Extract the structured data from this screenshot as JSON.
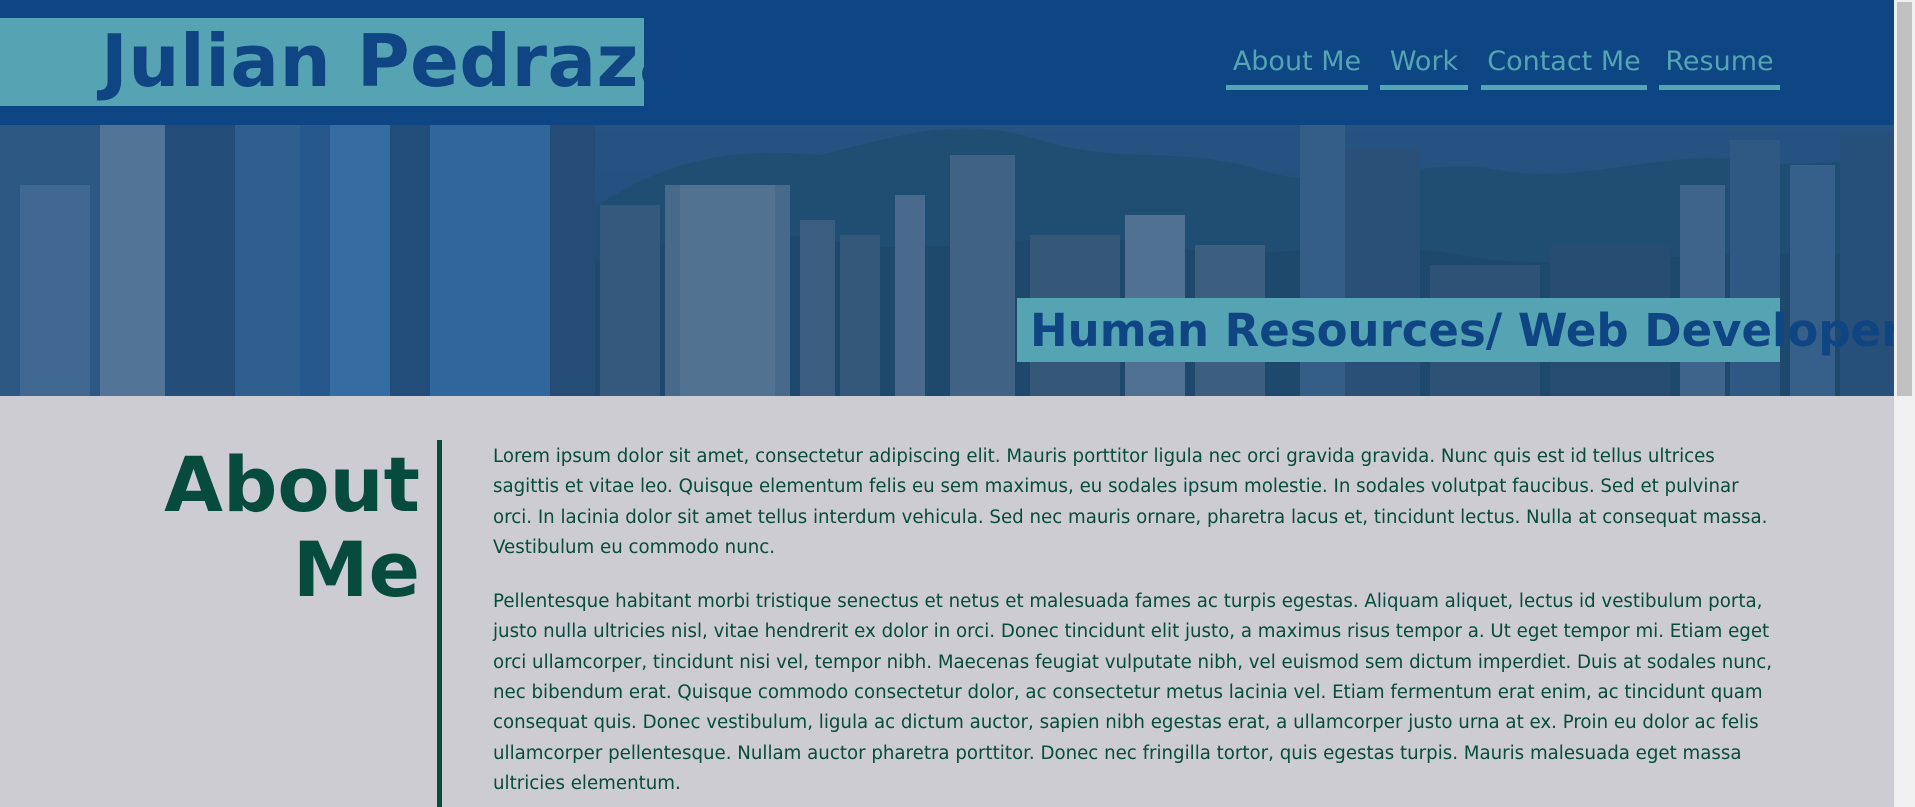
{
  "header": {
    "name": "Julian Pedraza",
    "nav": [
      {
        "label": "About Me"
      },
      {
        "label": "Work"
      },
      {
        "label": "Contact Me"
      },
      {
        "label": "Resume"
      }
    ]
  },
  "hero": {
    "tagline": "Human Resources/ Web Developer"
  },
  "about": {
    "title": "About Me",
    "paragraphs": [
      "Lorem ipsum dolor sit amet, consectetur adipiscing elit. Mauris porttitor ligula nec orci gravida gravida. Nunc quis est id tellus ultrices sagittis et vitae leo. Quisque elementum felis eu sem maximus, eu sodales ipsum molestie. In sodales volutpat faucibus. Sed et pulvinar orci. In lacinia dolor sit amet tellus interdum vehicula. Sed nec mauris ornare, pharetra lacus et, tincidunt lectus. Nulla at consequat massa. Vestibulum eu commodo nunc.",
      "Pellentesque habitant morbi tristique senectus et netus et malesuada fames ac turpis egestas. Aliquam aliquet, lectus id vestibulum porta, justo nulla ultricies nisl, vitae hendrerit ex dolor in orci. Donec tincidunt elit justo, a maximus risus tempor a. Ut eget tempor mi. Etiam eget orci ullamcorper, tincidunt nisi vel, tempor nibh. Maecenas feugiat vulputate nibh, vel euismod sem dictum imperdiet. Duis at sodales nunc, nec bibendum erat. Quisque commodo consectetur dolor, ac consectetur metus lacinia vel. Etiam fermentum erat enim, ac tincidunt quam consequat quis. Donec vestibulum, ligula ac dictum auctor, sapien nibh egestas erat, a ullamcorper justo urna at ex. Proin eu dolor ac felis ullamcorper pellentesque. Nullam auctor pharetra porttitor. Donec nec fringilla tortor, quis egestas turpis. Mauris malesuada eget massa ultricies elementum."
    ]
  },
  "colors": {
    "header_bg": "#0e4583",
    "accent_teal": "#56a3b4",
    "section_bg": "#ccccd2",
    "text_green": "#074b3c"
  }
}
